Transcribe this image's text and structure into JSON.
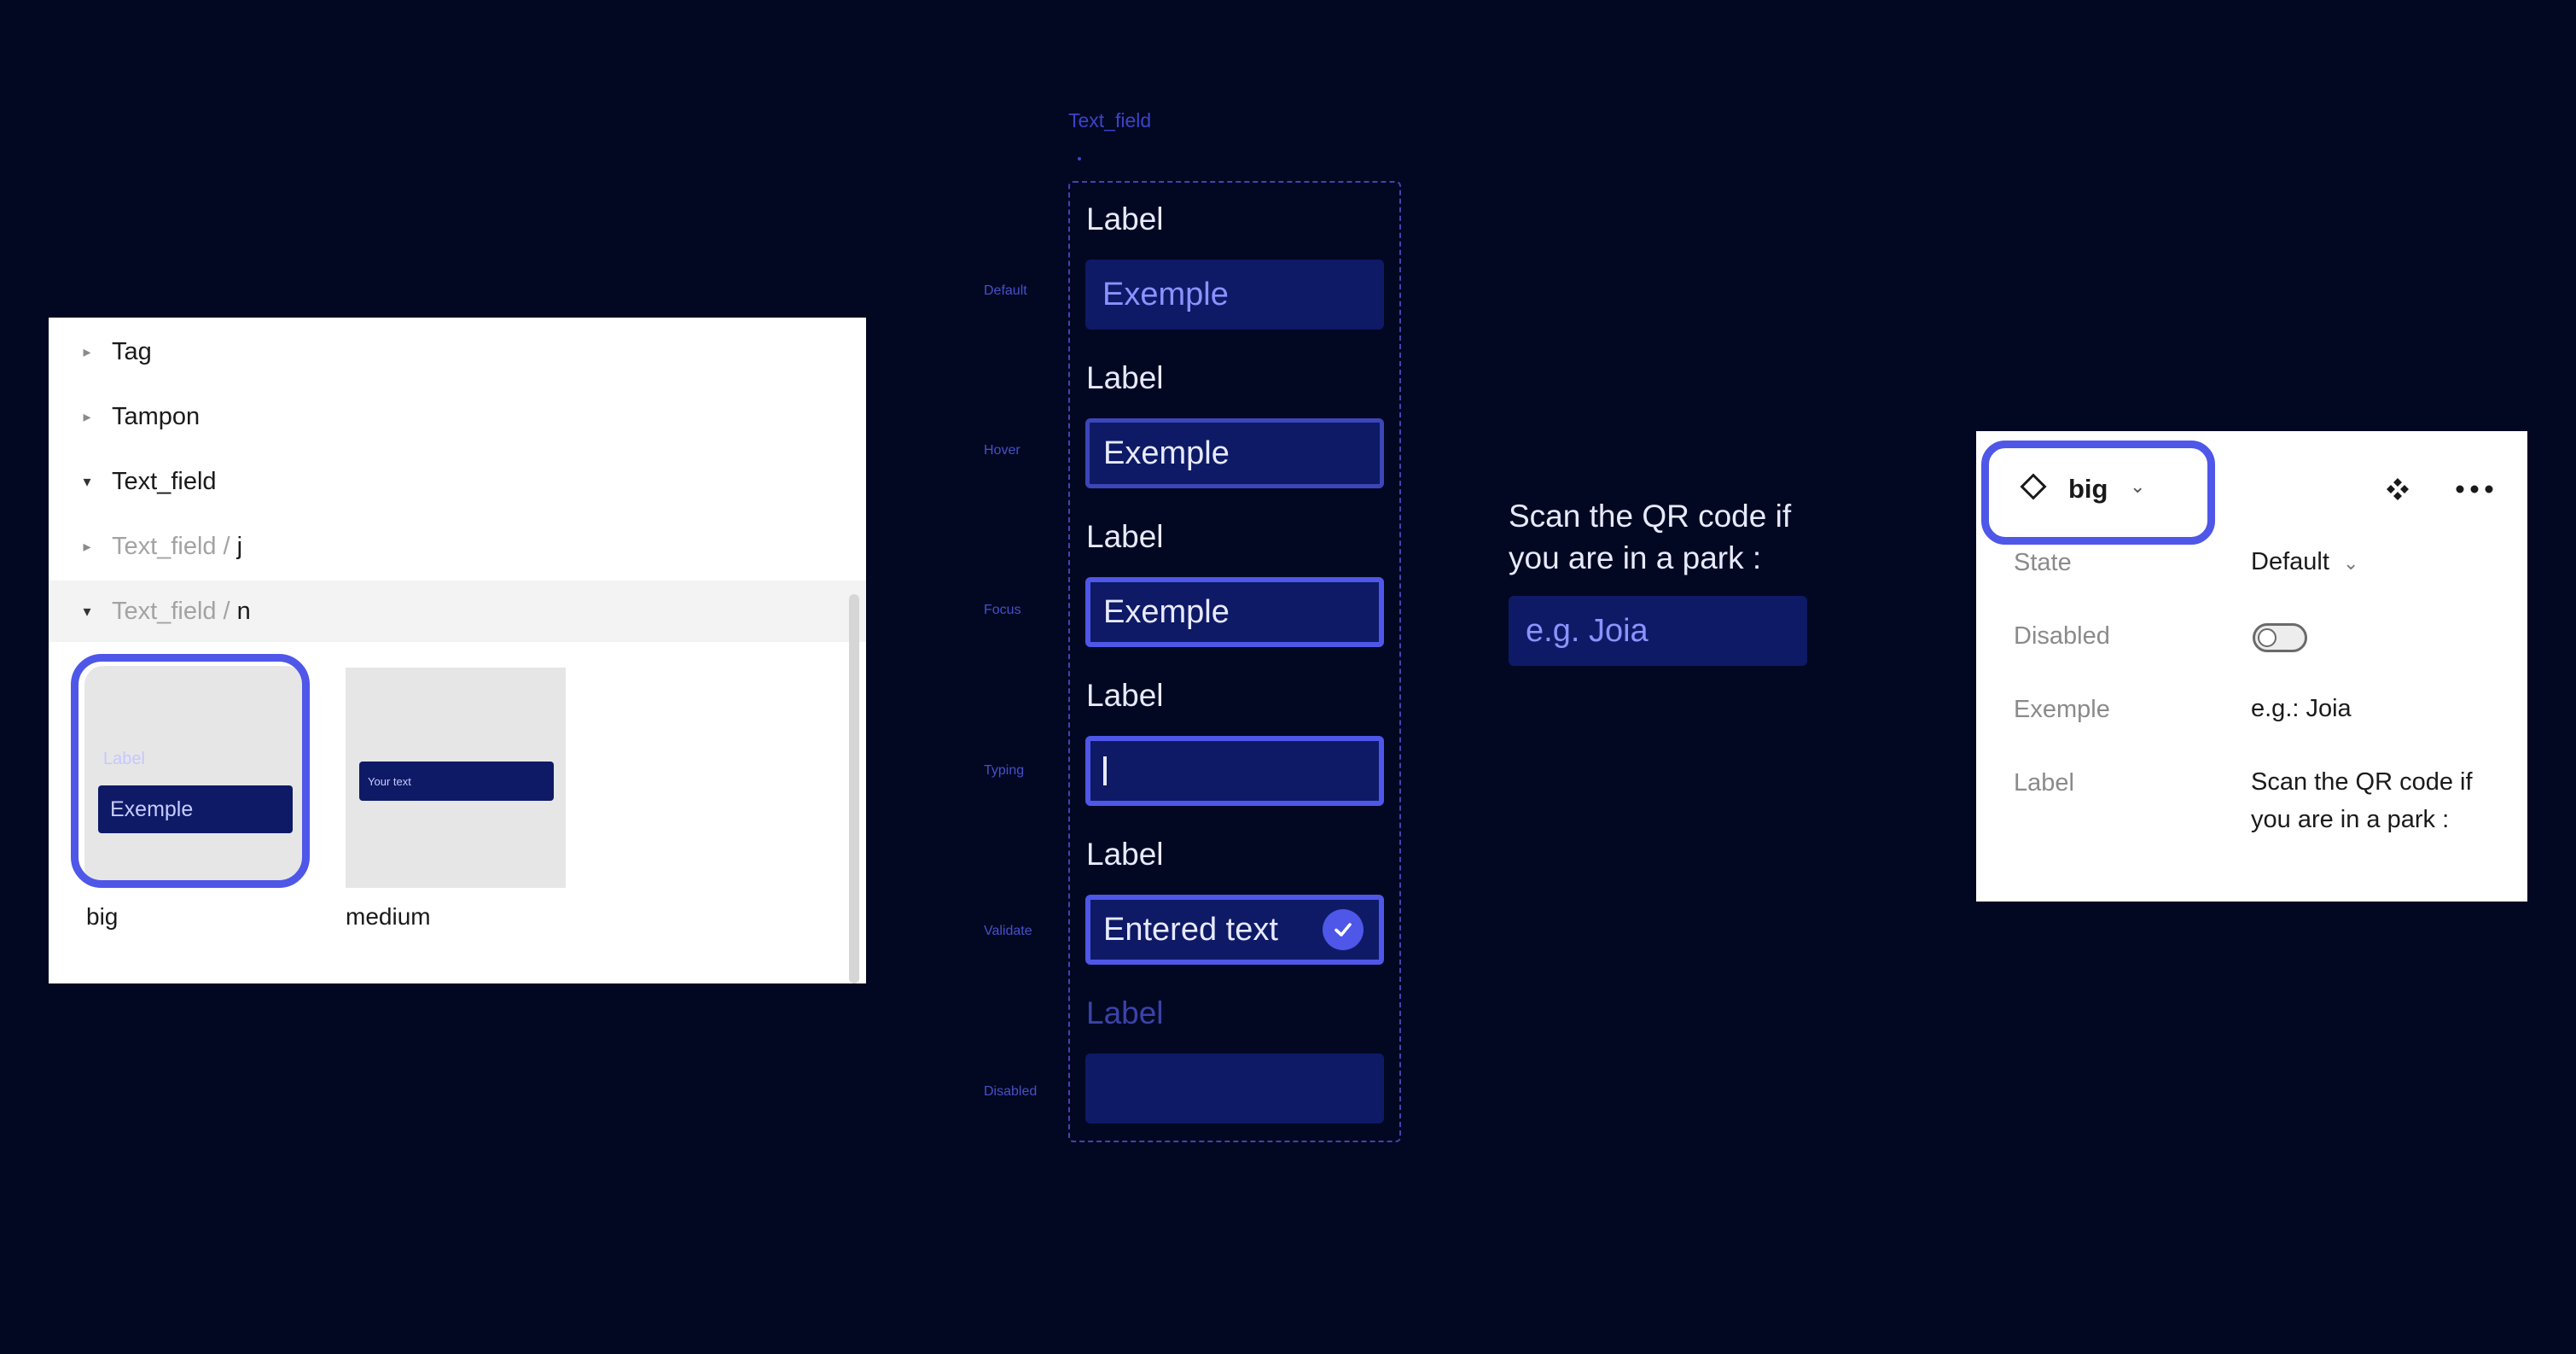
{
  "layers_panel": {
    "items": [
      {
        "label": "Tag"
      },
      {
        "label": "Tampon"
      },
      {
        "label": "Text_field"
      },
      {
        "parent": "Text_field",
        "name": "j"
      },
      {
        "parent": "Text_field",
        "name": "n"
      }
    ],
    "separator": "/",
    "variants": [
      {
        "name": "big",
        "preview_label": "Label",
        "preview_value": "Exemple"
      },
      {
        "name": "medium",
        "preview_value": "Your text"
      }
    ]
  },
  "component_set": {
    "title": "Text_field",
    "states": [
      {
        "state": "Default",
        "label": "Label",
        "value": "Exemple"
      },
      {
        "state": "Hover",
        "label": "Label",
        "value": "Exemple"
      },
      {
        "state": "Focus",
        "label": "Label",
        "value": "Exemple"
      },
      {
        "state": "Typing",
        "label": "Label",
        "value": ""
      },
      {
        "state": "Validate",
        "label": "Label",
        "value": "Entered text"
      },
      {
        "state": "Disabled",
        "label": "Label",
        "value": ""
      }
    ]
  },
  "preview": {
    "label": "Scan the QR code if you are in a park :",
    "placeholder": "e.g. Joia"
  },
  "properties_panel": {
    "variant": "big",
    "icons": [
      "component-diamond-icon",
      "chevron-down-icon",
      "component-set-icon",
      "more-icon"
    ],
    "rows": [
      {
        "key": "State",
        "value": "Default"
      },
      {
        "key": "Disabled",
        "value": false
      },
      {
        "key": "Exemple",
        "value": "e.g.: Joia"
      },
      {
        "key": "Label",
        "value": "Scan the QR code if you are in a park :"
      }
    ]
  },
  "colors": {
    "background": "#020822",
    "field": "#0e1a66",
    "accent": "#4e57e8",
    "placeholder": "#8a93ff",
    "text": "#e8eaff"
  }
}
